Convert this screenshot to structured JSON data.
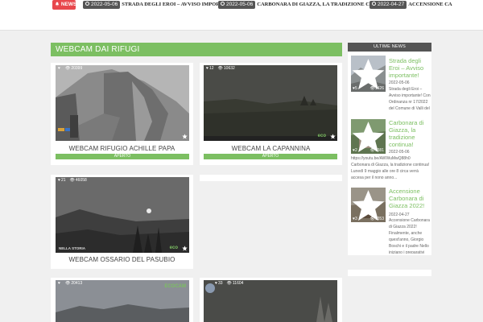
{
  "ticker": {
    "badge_label": "NEWS",
    "items": [
      {
        "date": "2022-05-06",
        "title": "STRADA DEGLI EROI – AVVISO IMPORTANTE!"
      },
      {
        "date": "2022-05-06",
        "title": "CARBONARA DI GIAZZA, LA TRADIZIONE CONTINUA!"
      },
      {
        "date": "2022-04-27",
        "title": "ACCENSIONE CA"
      }
    ]
  },
  "section": {
    "title": "WEBCAM DAI RIFUGI"
  },
  "cards": [
    {
      "title": "WEBCAM RIFUGIO ACHILLE PAPA",
      "likes": "",
      "views": "20399",
      "status": "APERTO"
    },
    {
      "title": "WEBCAM LA CAPANNINA",
      "likes": "12",
      "views": "10632",
      "status": "APERTO"
    },
    {
      "title": "WEBCAM OSSARIO DEL PASUBIO",
      "likes": "21",
      "views": "46058",
      "status": ""
    },
    {
      "title": "",
      "likes": "",
      "views": "20413",
      "status": ""
    },
    {
      "title": "",
      "likes": "33",
      "views": "11604",
      "status": ""
    }
  ],
  "cam_labels": {
    "eco_logo": "eco",
    "ecocam_logo": "ECOCAM",
    "ossario_watermark": "NELLA STORIA"
  },
  "sidebar": {
    "title": "ULTIME NEWS",
    "posts": [
      {
        "title": "Strada degli Eroi – Avviso importante!",
        "date": "2022-05-06",
        "likes": "5",
        "views": "1426",
        "excerpt": "Strada degli Eroi – Avviso importante! Con Ordinanza nr 17/2022 del Comune di Valli del Pasubio viene istituito il DIVIETO..."
      },
      {
        "title": "Carbonara di Giazza, la tradizione continua!",
        "date": "2022-05-06",
        "likes": "2",
        "views": "1381",
        "excerpt": "https://youtu.be/AWWuMwQ88h0 Carbonara di Giazza, la tradizione continua! Lunedì 9 maggio alle ore 8 circa verrà accesa per il nono anno..."
      },
      {
        "title": "Accensione Carbonara di Giazza 2022!",
        "date": "2022-04-27",
        "likes": "3",
        "views": "1353",
        "excerpt": "Accensione Carbonara di Giazza 2022! Finalmente, anche quest'anno, Giorgio Boschi e il padre Nello iniziano i preparativi per l'accensione della..."
      }
    ]
  }
}
